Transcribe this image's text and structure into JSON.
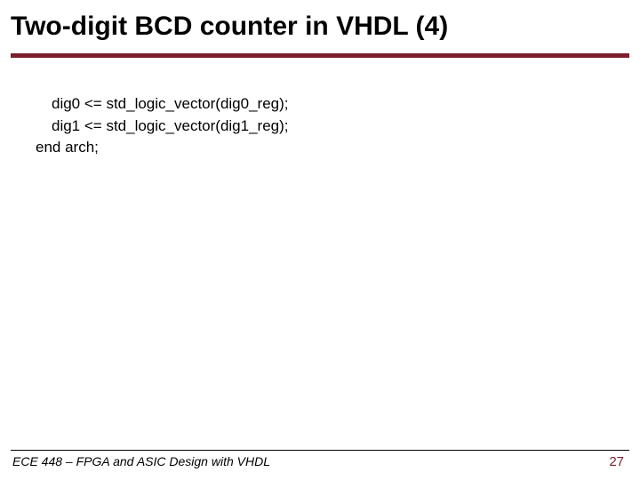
{
  "title": "Two-digit BCD counter in VHDL (4)",
  "code": {
    "line0": "dig0 <= std_logic_vector(dig0_reg);",
    "line1": "dig1 <= std_logic_vector(dig1_reg);",
    "line2": "end arch;"
  },
  "footer": {
    "course": "ECE 448 – FPGA and ASIC Design with VHDL",
    "page": "27"
  }
}
